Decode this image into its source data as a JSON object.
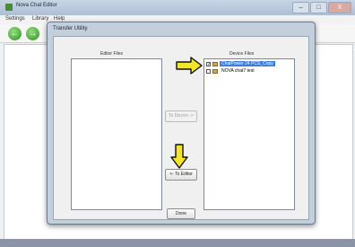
{
  "app": {
    "title": "Nova Chat Editor"
  },
  "menu": {
    "settings": "Settings",
    "library": "Library",
    "help": "Help"
  },
  "window_controls": {
    "minimize": "–",
    "maximize": "□",
    "close": "X"
  },
  "dialog": {
    "title": "Transfer Utility",
    "editor_files_label": "Editor Files",
    "device_files_label": "Device Files",
    "to_device_label": "To Device ->",
    "to_editor_label": "<- To Editor",
    "done_label": "Done",
    "device_files": [
      {
        "name": "ChatPower 24 PCS_Copy",
        "checked": true,
        "selected": true
      },
      {
        "name": "NOVA chat7 test",
        "checked": false,
        "selected": false
      }
    ]
  },
  "annotation_color": "#f2e62a"
}
